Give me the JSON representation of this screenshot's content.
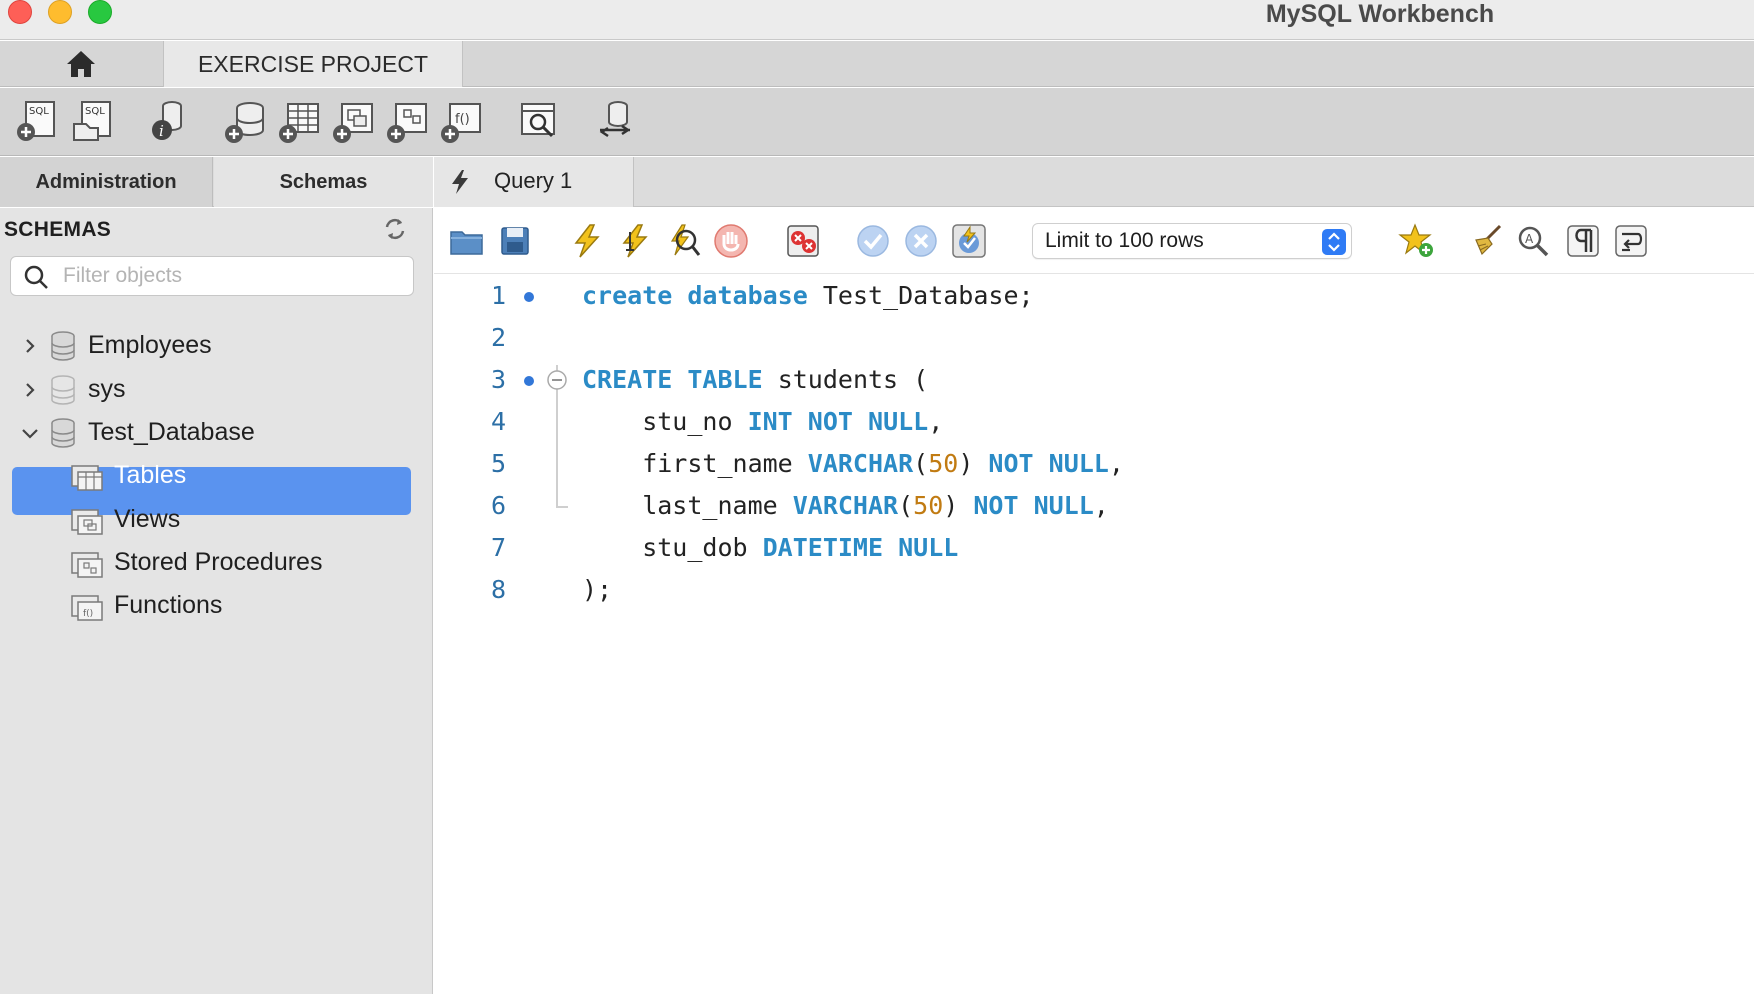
{
  "window": {
    "title": "MySQL Workbench"
  },
  "tabs": {
    "home": "home",
    "project": "EXERCISE PROJECT"
  },
  "main_toolbar": {
    "icons": [
      "new-sql-tab-icon",
      "open-sql-script-icon",
      "inspector-icon",
      "create-schema-icon",
      "create-table-icon",
      "create-view-icon",
      "create-procedure-icon",
      "create-function-icon",
      "search-table-data-icon",
      "reconnect-icon"
    ]
  },
  "left_tabs": {
    "administration": "Administration",
    "schemas": "Schemas"
  },
  "sidebar": {
    "heading": "SCHEMAS",
    "filter_placeholder": "Filter objects",
    "tree": [
      {
        "label": "Employees",
        "expanded": false
      },
      {
        "label": "sys",
        "expanded": false
      },
      {
        "label": "Test_Database",
        "expanded": true,
        "children": [
          "Tables",
          "Views",
          "Stored Procedures",
          "Functions"
        ],
        "selected_child": "Tables"
      }
    ]
  },
  "query_tab": {
    "label": "Query 1"
  },
  "editor_toolbar": {
    "limit_label": "Limit to 100 rows",
    "icons": [
      "open-file-icon",
      "save-icon",
      "execute-icon",
      "execute-current-icon",
      "explain-icon",
      "stop-icon",
      "toggle-error-icon",
      "commit-icon",
      "rollback-icon",
      "autocommit-icon",
      "add-snippet-icon",
      "beautify-icon",
      "find-icon",
      "invisible-chars-icon",
      "wrap-lines-icon"
    ]
  },
  "editor": {
    "lines": [
      {
        "n": "1",
        "text": "create database Test_Database;"
      },
      {
        "n": "2",
        "text": ""
      },
      {
        "n": "3",
        "text": "CREATE TABLE students ("
      },
      {
        "n": "4",
        "text": "    stu_no INT NOT NULL,"
      },
      {
        "n": "5",
        "text": "    first_name VARCHAR(50) NOT NULL,"
      },
      {
        "n": "6",
        "text": "    last_name VARCHAR(50) NOT NULL,"
      },
      {
        "n": "7",
        "text": "    stu_dob DATETIME NULL"
      },
      {
        "n": "8",
        "text": ");"
      }
    ]
  },
  "colors": {
    "keyword": "#2b8bc6",
    "number": "#c17b12",
    "selection": "#5a93ef",
    "line_number": "#2c6fa6"
  }
}
